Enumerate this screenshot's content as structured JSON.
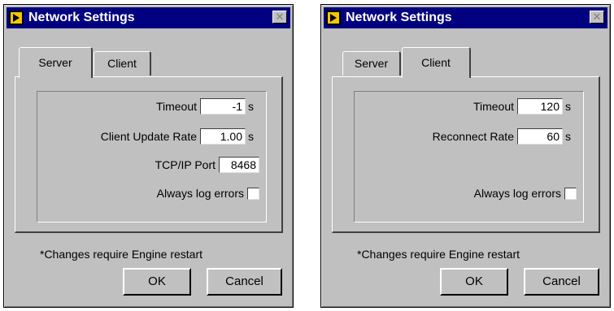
{
  "dialogs": [
    {
      "title": "Network Settings",
      "close_symbol": "✕",
      "tabs": [
        {
          "label": "Server",
          "active": true
        },
        {
          "label": "Client",
          "active": false
        }
      ],
      "fields": {
        "timeout": {
          "label": "Timeout",
          "value": "-1",
          "unit": "s"
        },
        "update_rate": {
          "label": "Client Update Rate",
          "value": "1.00",
          "unit": "s"
        },
        "port": {
          "label": "TCP/IP Port",
          "value": "8468"
        },
        "log_errors": {
          "label": "Always log errors",
          "checked": false
        }
      },
      "note": "*Changes require Engine restart",
      "ok_label": "OK",
      "cancel_label": "Cancel"
    },
    {
      "title": "Network Settings",
      "close_symbol": "✕",
      "tabs": [
        {
          "label": "Server",
          "active": false
        },
        {
          "label": "Client",
          "active": true
        }
      ],
      "fields": {
        "timeout": {
          "label": "Timeout",
          "value": "120",
          "unit": "s"
        },
        "reconnect_rate": {
          "label": "Reconnect Rate",
          "value": "60",
          "unit": "s"
        },
        "log_errors": {
          "label": "Always log errors",
          "checked": false
        }
      },
      "note": "*Changes require Engine restart",
      "ok_label": "OK",
      "cancel_label": "Cancel"
    }
  ],
  "colors": {
    "titlebar": "#000080",
    "face": "#c0c0c0",
    "icon_background": "#f0c800"
  },
  "icons": {
    "app": "labview-arrow-icon",
    "close": "close-icon"
  }
}
